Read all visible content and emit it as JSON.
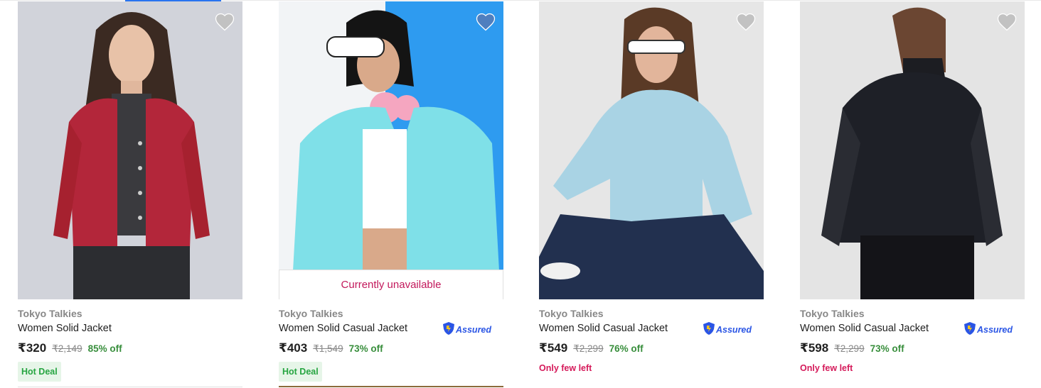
{
  "products": [
    {
      "brand": "Tokyo Talkies",
      "title": "Women Solid Jacket",
      "price": "₹320",
      "mrp": "₹2,149",
      "discount": "85% off",
      "tag": "Hot Deal",
      "assured": false
    },
    {
      "brand": "Tokyo Talkies",
      "title": "Women Solid Casual Jacket",
      "price": "₹403",
      "mrp": "₹1,549",
      "discount": "73% off",
      "tag": "Hot Deal",
      "assured": true,
      "assured_label": "Assured",
      "availability": "Currently unavailable"
    },
    {
      "brand": "Tokyo Talkies",
      "title": "Women Solid Casual Jacket",
      "price": "₹549",
      "mrp": "₹2,299",
      "discount": "76% off",
      "stock_note": "Only few left",
      "assured": true,
      "assured_label": "Assured"
    },
    {
      "brand": "Tokyo Talkies",
      "title": "Women Solid Casual Jacket",
      "price": "₹598",
      "mrp": "₹2,299",
      "discount": "73% off",
      "stock_note": "Only few left",
      "assured": true,
      "assured_label": "Assured"
    }
  ],
  "colors": {
    "discount": "#388e3c",
    "hot_deal_bg": "#e6f5e8",
    "hot_deal_text": "#26a541",
    "few_left": "#d51a5a",
    "unavailable": "#c2185b",
    "assured": "#2a55e5",
    "wishlist_inactive": "#c2c2c2",
    "wishlist_active": "#4f7fbf"
  },
  "icons": {
    "wishlist": "heart-icon",
    "assured": "shield-icon"
  }
}
